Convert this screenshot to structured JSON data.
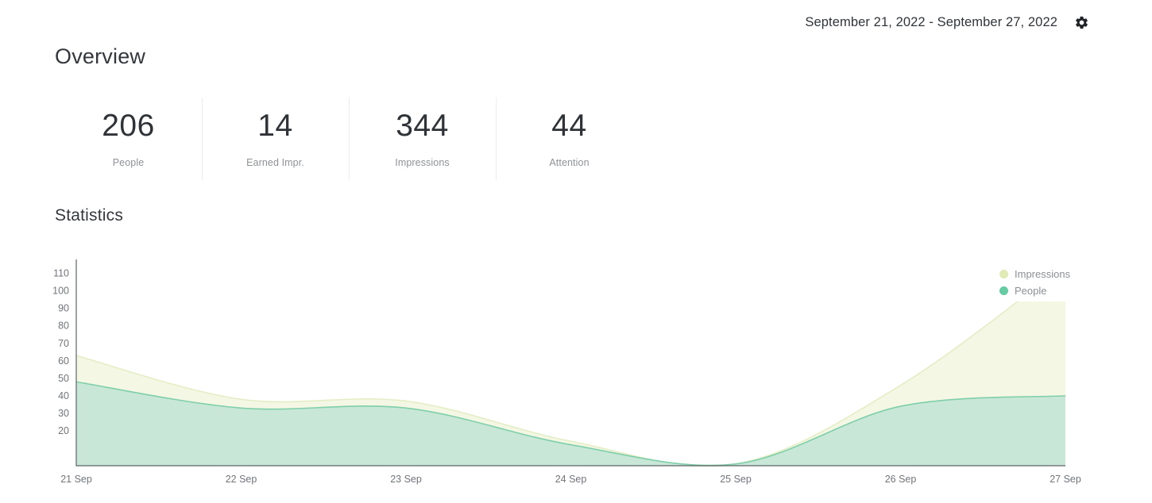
{
  "header": {
    "date_range": "September 21, 2022 - September 27, 2022",
    "settings_icon": "gear-icon"
  },
  "overview": {
    "title": "Overview",
    "metrics": [
      {
        "value": "206",
        "label": "People"
      },
      {
        "value": "14",
        "label": "Earned Impr."
      },
      {
        "value": "344",
        "label": "Impressions"
      },
      {
        "value": "44",
        "label": "Attention"
      }
    ]
  },
  "statistics": {
    "title": "Statistics"
  },
  "colors": {
    "impressions_fill": "#f3f7e4",
    "impressions_stroke": "#e4eec6",
    "impressions_dot": "#dfeab5",
    "people_fill": "#c9e7d6",
    "people_stroke": "#7ecfaa",
    "people_dot": "#66cba2",
    "axis": "#5f6368",
    "tick_text": "#70757a"
  },
  "chart_data": {
    "type": "area",
    "title": "Statistics",
    "xlabel": "",
    "ylabel": "",
    "grid": false,
    "legend_position": "top-right",
    "ylim": [
      0,
      118
    ],
    "yticks": [
      20,
      30,
      40,
      50,
      60,
      70,
      80,
      90,
      100,
      110
    ],
    "x": [
      "21 Sep",
      "22 Sep",
      "23 Sep",
      "24 Sep",
      "25 Sep",
      "26 Sep",
      "27 Sep"
    ],
    "series": [
      {
        "name": "Impressions",
        "values": [
          63,
          38,
          37,
          14,
          1,
          46,
          115
        ]
      },
      {
        "name": "People",
        "values": [
          48,
          33,
          33,
          12,
          1,
          34,
          40
        ]
      }
    ]
  }
}
